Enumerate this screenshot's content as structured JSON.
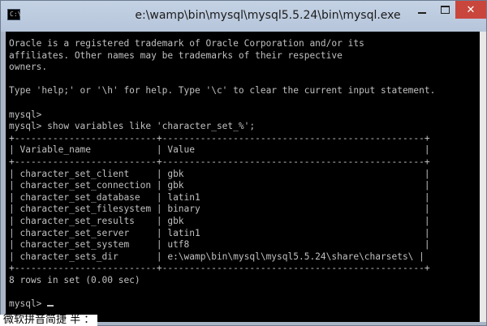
{
  "window": {
    "title": "e:\\wamp\\bin\\mysql\\mysql5.5.24\\bin\\mysql.exe",
    "icon_prompt": "C:\\",
    "close_glyph": "✕"
  },
  "console": {
    "lines": [
      "Oracle is a registered trademark of Oracle Corporation and/or its",
      "affiliates. Other names may be trademarks of their respective",
      "owners.",
      "",
      "Type 'help;' or '\\h' for help. Type '\\c' to clear the current input statement.",
      "",
      "mysql>",
      "mysql> show variables like 'character_set_%';",
      "+--------------------------+------------------------------------------------+",
      "| Variable_name            | Value                                          |",
      "+--------------------------+------------------------------------------------+",
      "| character_set_client     | gbk                                            |",
      "| character_set_connection | gbk                                            |",
      "| character_set_database   | latin1                                         |",
      "| character_set_filesystem | binary                                         |",
      "| character_set_results    | gbk                                            |",
      "| character_set_server     | latin1                                         |",
      "| character_set_system     | utf8                                           |",
      "| character_sets_dir       | e:\\wamp\\bin\\mysql\\mysql5.5.24\\share\\charsets\\ |",
      "+--------------------------+------------------------------------------------+",
      "8 rows in set (0.00 sec)",
      ""
    ],
    "prompt": "mysql> "
  },
  "ime": {
    "status": "微软拼音简捷 半 ："
  },
  "colors": {
    "console_bg": "#000000",
    "console_text": "#c0c0c0",
    "titlebar": "#b6c5da",
    "close_button": "#c9463d"
  }
}
